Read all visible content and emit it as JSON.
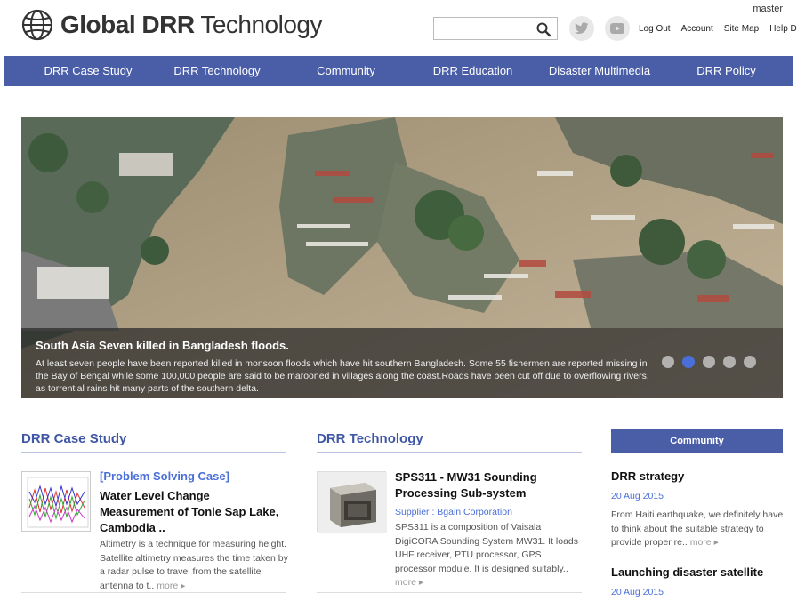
{
  "header": {
    "logo_bold": "Global DRR",
    "logo_light": " Technology",
    "user": "master",
    "search_placeholder": "",
    "util_links": [
      "Log Out",
      "Account",
      "Site Map",
      "Help Desk"
    ]
  },
  "nav": [
    "DRR Case Study",
    "DRR Technology",
    "Community",
    "DRR Education",
    "Disaster Multimedia",
    "DRR Policy"
  ],
  "hero": {
    "title": "South Asia Seven killed in Bangladesh floods.",
    "text": "At least seven people have been reported killed in monsoon floods which have hit southern Bangladesh. Some 55 fishermen are reported missing in the Bay of Bengal while some 100,000 people are said to be marooned in villages along the coast.Roads have been cut off due to overflowing rivers, as torrential rains hit many parts of the southern delta.",
    "slide_count": 5,
    "active_slide": 2
  },
  "case_study": {
    "heading": "DRR Case Study",
    "tag": "[Problem Solving Case]",
    "title": "Water Level Change Measurement of Tonle Sap Lake, Cambodia ..",
    "desc": "Altimetry is a technique for measuring height. Satellite altimetry measures the time taken by a radar pulse to travel from the satellite antenna to t..",
    "more": "more"
  },
  "technology": {
    "heading": "DRR Technology",
    "title": "SPS311 - MW31 Sounding Processing Sub-system",
    "supplier": "Supplier : Bgain Corporation",
    "desc": "SPS311 is a composition of Vaisala DigiCORA Sounding System MW31. It loads UHF receiver, PTU processor, GPS processor module. It is designed suitably..",
    "more": "more"
  },
  "community": {
    "heading": "Community",
    "items": [
      {
        "title": "DRR strategy",
        "date": "20 Aug 2015",
        "desc": "From Haiti earthquake, we definitely have to think about the suitable strategy to provide proper re..",
        "more": "more"
      },
      {
        "title": "Launching disaster satellite",
        "date": "20 Aug 2015"
      }
    ]
  },
  "colors": {
    "nav_bg": "#4a5ea8",
    "accent": "#3f56a5",
    "link": "#4a6fd8"
  }
}
